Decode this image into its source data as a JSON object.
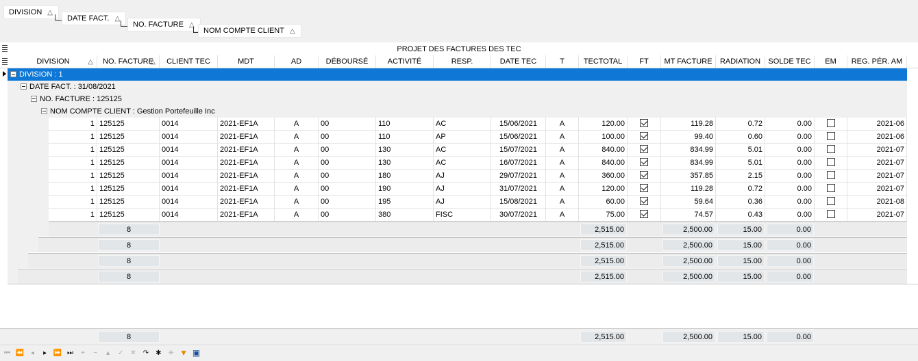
{
  "groupby": {
    "chips": [
      {
        "label": "DIVISION",
        "sort": "△"
      },
      {
        "label": "DATE FACT.",
        "sort": "△"
      },
      {
        "label": "NO. FACTURE",
        "sort": "△"
      },
      {
        "label": "NOM COMPTE CLIENT",
        "sort": "△"
      }
    ]
  },
  "grid": {
    "title": "PROJET DES FACTURES DES TEC",
    "columns": [
      {
        "label": "DIVISION",
        "sort": "△"
      },
      {
        "label": "NO. FACTURE",
        "sort": "△"
      },
      {
        "label": "CLIENT TEC"
      },
      {
        "label": "MDT"
      },
      {
        "label": "AD"
      },
      {
        "label": "DÉBOURSÉ"
      },
      {
        "label": "ACTIVITÉ"
      },
      {
        "label": "RESP."
      },
      {
        "label": "DATE TEC"
      },
      {
        "label": "T"
      },
      {
        "label": "TECTOTAL"
      },
      {
        "label": "FT"
      },
      {
        "label": "MT FACTURE"
      },
      {
        "label": "RADIATION"
      },
      {
        "label": "SOLDE TEC"
      },
      {
        "label": "EM"
      },
      {
        "label": "REG. PÉR. AM"
      }
    ],
    "groups": [
      "DIVISION : 1",
      "DATE FACT. : 31/08/2021",
      "NO. FACTURE : 125125",
      "NOM COMPTE CLIENT : Gestion Portefeuille Inc"
    ],
    "rows": [
      {
        "division": "1",
        "no_facture": "125125",
        "client_tec": "0014",
        "mdt": "2021-EF1A",
        "ad": "A",
        "debourse": "00",
        "activite": "110",
        "resp": "AC",
        "date_tec": "15/06/2021",
        "t": "A",
        "tectotal": "120.00",
        "ft": true,
        "mt_facture": "119.28",
        "radiation": "0.72",
        "solde_tec": "0.00",
        "em": false,
        "reg_per_am": "2021-06"
      },
      {
        "division": "1",
        "no_facture": "125125",
        "client_tec": "0014",
        "mdt": "2021-EF1A",
        "ad": "A",
        "debourse": "00",
        "activite": "110",
        "resp": "AP",
        "date_tec": "15/06/2021",
        "t": "A",
        "tectotal": "100.00",
        "ft": true,
        "mt_facture": "99.40",
        "radiation": "0.60",
        "solde_tec": "0.00",
        "em": false,
        "reg_per_am": "2021-06"
      },
      {
        "division": "1",
        "no_facture": "125125",
        "client_tec": "0014",
        "mdt": "2021-EF1A",
        "ad": "A",
        "debourse": "00",
        "activite": "130",
        "resp": "AC",
        "date_tec": "15/07/2021",
        "t": "A",
        "tectotal": "840.00",
        "ft": true,
        "mt_facture": "834.99",
        "radiation": "5.01",
        "solde_tec": "0.00",
        "em": false,
        "reg_per_am": "2021-07"
      },
      {
        "division": "1",
        "no_facture": "125125",
        "client_tec": "0014",
        "mdt": "2021-EF1A",
        "ad": "A",
        "debourse": "00",
        "activite": "130",
        "resp": "AC",
        "date_tec": "16/07/2021",
        "t": "A",
        "tectotal": "840.00",
        "ft": true,
        "mt_facture": "834.99",
        "radiation": "5.01",
        "solde_tec": "0.00",
        "em": false,
        "reg_per_am": "2021-07"
      },
      {
        "division": "1",
        "no_facture": "125125",
        "client_tec": "0014",
        "mdt": "2021-EF1A",
        "ad": "A",
        "debourse": "00",
        "activite": "180",
        "resp": "AJ",
        "date_tec": "29/07/2021",
        "t": "A",
        "tectotal": "360.00",
        "ft": true,
        "mt_facture": "357.85",
        "radiation": "2.15",
        "solde_tec": "0.00",
        "em": false,
        "reg_per_am": "2021-07"
      },
      {
        "division": "1",
        "no_facture": "125125",
        "client_tec": "0014",
        "mdt": "2021-EF1A",
        "ad": "A",
        "debourse": "00",
        "activite": "190",
        "resp": "AJ",
        "date_tec": "31/07/2021",
        "t": "A",
        "tectotal": "120.00",
        "ft": true,
        "mt_facture": "119.28",
        "radiation": "0.72",
        "solde_tec": "0.00",
        "em": false,
        "reg_per_am": "2021-07"
      },
      {
        "division": "1",
        "no_facture": "125125",
        "client_tec": "0014",
        "mdt": "2021-EF1A",
        "ad": "A",
        "debourse": "00",
        "activite": "195",
        "resp": "AJ",
        "date_tec": "15/08/2021",
        "t": "A",
        "tectotal": "60.00",
        "ft": true,
        "mt_facture": "59.64",
        "radiation": "0.36",
        "solde_tec": "0.00",
        "em": false,
        "reg_per_am": "2021-08"
      },
      {
        "division": "1",
        "no_facture": "125125",
        "client_tec": "0014",
        "mdt": "2021-EF1A",
        "ad": "A",
        "debourse": "00",
        "activite": "380",
        "resp": "FISC",
        "date_tec": "30/07/2021",
        "t": "A",
        "tectotal": "75.00",
        "ft": true,
        "mt_facture": "74.57",
        "radiation": "0.43",
        "solde_tec": "0.00",
        "em": false,
        "reg_per_am": "2021-07"
      }
    ],
    "group_summaries": [
      {
        "count": "8",
        "tectotal": "2,515.00",
        "mt_facture": "2,500.00",
        "radiation": "15.00",
        "solde_tec": "0.00"
      },
      {
        "count": "8",
        "tectotal": "2,515.00",
        "mt_facture": "2,500.00",
        "radiation": "15.00",
        "solde_tec": "0.00"
      },
      {
        "count": "8",
        "tectotal": "2,515.00",
        "mt_facture": "2,500.00",
        "radiation": "15.00",
        "solde_tec": "0.00"
      },
      {
        "count": "8",
        "tectotal": "2,515.00",
        "mt_facture": "2,500.00",
        "radiation": "15.00",
        "solde_tec": "0.00"
      }
    ],
    "total": {
      "count": "8",
      "tectotal": "2,515.00",
      "mt_facture": "2,500.00",
      "radiation": "15.00",
      "solde_tec": "0.00"
    }
  },
  "navigator": [
    {
      "name": "first-record-button",
      "glyph": "⏮",
      "enabled": false
    },
    {
      "name": "prev-page-button",
      "glyph": "⏪",
      "enabled": false
    },
    {
      "name": "prev-record-button",
      "glyph": "◂",
      "enabled": false
    },
    {
      "name": "next-record-button",
      "glyph": "▸",
      "enabled": true
    },
    {
      "name": "next-page-button",
      "glyph": "⏩",
      "enabled": true
    },
    {
      "name": "last-record-button",
      "glyph": "⏭",
      "enabled": true
    },
    {
      "name": "append-button",
      "glyph": "+",
      "enabled": false
    },
    {
      "name": "delete-button",
      "glyph": "−",
      "enabled": false
    },
    {
      "name": "edit-button",
      "glyph": "▴",
      "enabled": false
    },
    {
      "name": "post-button",
      "glyph": "✓",
      "enabled": false
    },
    {
      "name": "cancel-button",
      "glyph": "✕",
      "enabled": false
    },
    {
      "name": "refresh-button",
      "glyph": "↷",
      "enabled": true
    },
    {
      "name": "bookmark-button",
      "glyph": "✱",
      "enabled": true
    },
    {
      "name": "goto-bookmark-button",
      "glyph": "✳",
      "enabled": false
    },
    {
      "name": "filter-button",
      "glyph": "▼",
      "enabled": true,
      "color": "#e08a00"
    },
    {
      "name": "print-button",
      "glyph": "▣",
      "enabled": true,
      "color": "#1a4f9c"
    }
  ]
}
